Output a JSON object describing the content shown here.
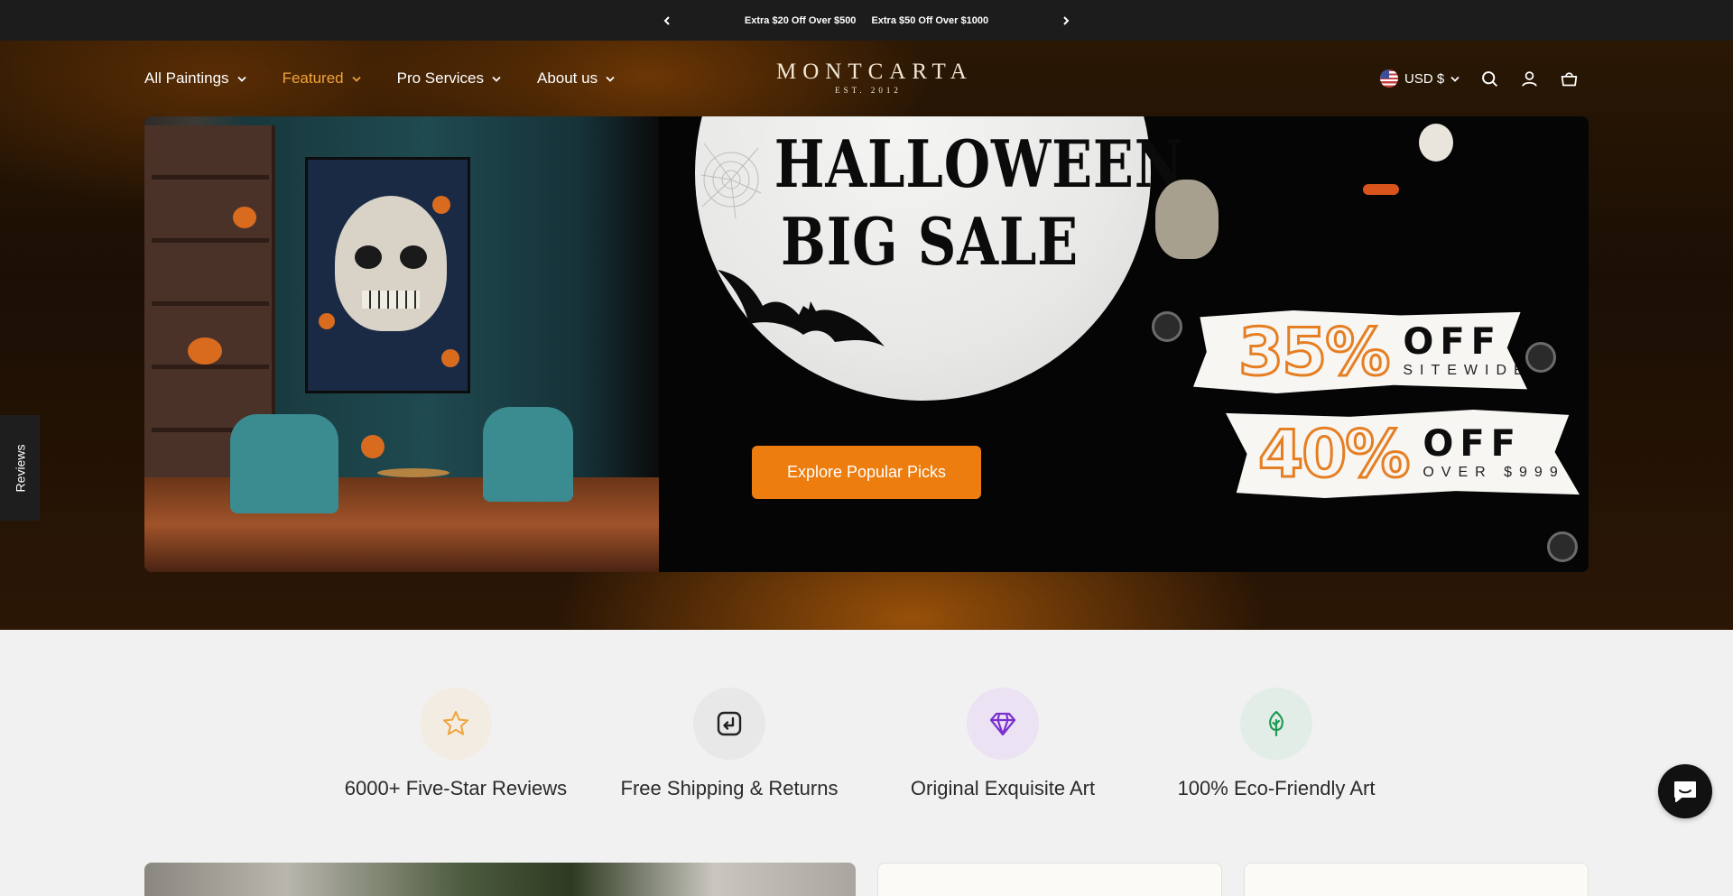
{
  "announcement": {
    "messages": [
      "Extra $20 Off Over $500",
      "Extra $50 Off Over $1000"
    ]
  },
  "header": {
    "nav": [
      {
        "label": "All Paintings",
        "active": false
      },
      {
        "label": "Featured",
        "active": true
      },
      {
        "label": "Pro Services",
        "active": false
      },
      {
        "label": "About us",
        "active": false
      }
    ],
    "logo": {
      "word": "MONTCARTA",
      "est": "EST. 2012"
    },
    "currency": "USD $",
    "icons": [
      "search-icon",
      "account-icon",
      "cart-icon"
    ]
  },
  "hero": {
    "title_line1": "HALLOWEEN",
    "title_line2": "BIG SALE",
    "offer1": {
      "percent": "35%",
      "off": "OFF",
      "sub": "SITEWIDE"
    },
    "offer2": {
      "percent": "40%",
      "off": "OFF",
      "sub": "OVER $999"
    },
    "cta": "Explore Popular Picks"
  },
  "reviews_tab": "Reviews",
  "features": [
    {
      "label": "6000+  Five-Star Reviews",
      "icon": "star-icon",
      "bg": "#f3ece2",
      "color": "#f0a33b"
    },
    {
      "label": "Free Shipping & Returns",
      "icon": "return-icon",
      "bg": "#e8e8e8",
      "color": "#222222"
    },
    {
      "label": "Original Exquisite Art",
      "icon": "diamond-icon",
      "bg": "#ebe3f3",
      "color": "#7b2fd1"
    },
    {
      "label": "100% Eco-Friendly Art",
      "icon": "tree-icon",
      "bg": "#e3ede7",
      "color": "#1f9a55"
    }
  ],
  "colors": {
    "accent": "#ec7d0e",
    "nav_active": "#f0a33b",
    "announce_bg": "#1c1c1c"
  }
}
